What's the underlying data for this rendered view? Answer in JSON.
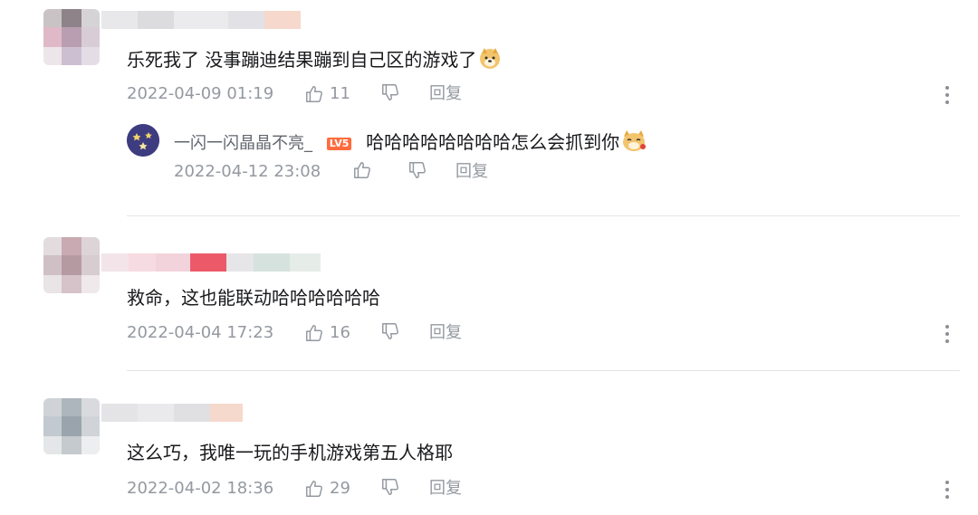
{
  "comments": [
    {
      "text": "乐死我了 没事蹦迪结果蹦到自己区的游戏了",
      "time": "2022-04-09 01:19",
      "likes": "11",
      "reply_label": "回复",
      "reply": {
        "username": "一闪一闪晶晶不亮_",
        "level": "LV5",
        "text": "哈哈哈哈哈哈哈哈怎么会抓到你",
        "time": "2022-04-12 23:08",
        "reply_label": "回复"
      }
    },
    {
      "text": "救命，这也能联动哈哈哈哈哈哈",
      "time": "2022-04-04 17:23",
      "likes": "16",
      "reply_label": "回复"
    },
    {
      "text": "这么巧，我唯一玩的手机游戏第五人格耶",
      "time": "2022-04-02 18:36",
      "likes": "29",
      "reply_label": "回复"
    }
  ],
  "colors": {
    "meta_text": "#9499a0",
    "divider": "#e3e5e7",
    "level_badge": "#ff6b3d"
  },
  "icons": [
    "thumbs-up-icon",
    "thumbs-down-icon",
    "more-vertical-icon",
    "doge-emoji-icon",
    "cat-emoji-icon"
  ]
}
